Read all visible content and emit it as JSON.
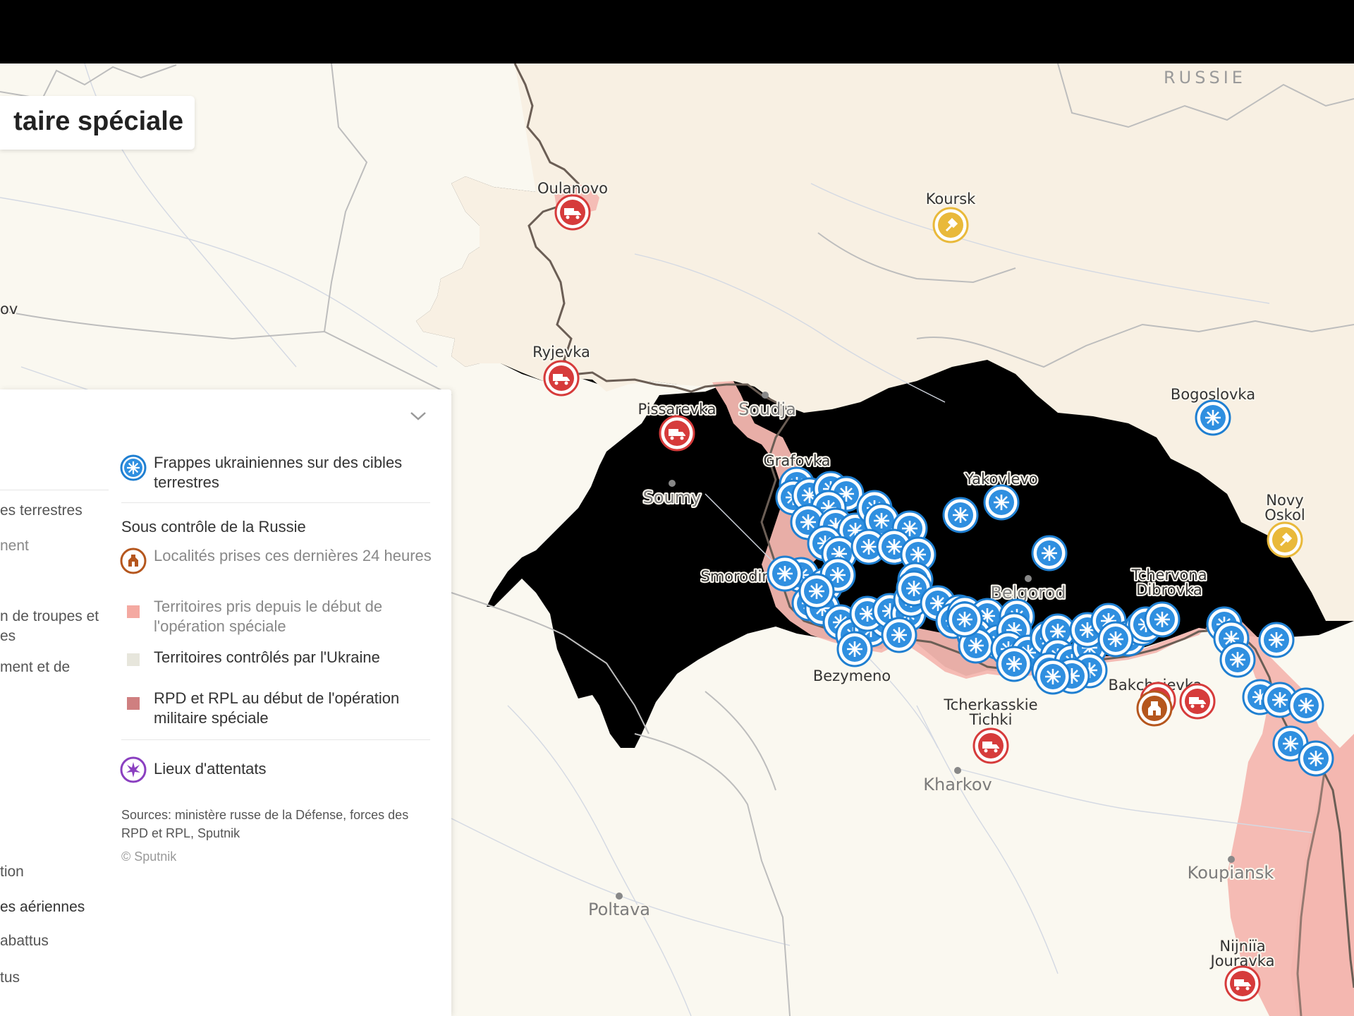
{
  "map": {
    "title": "taire spéciale",
    "country_label": "RUSSIE",
    "cities": [
      {
        "name": "Koursk",
        "style": "lbl"
      },
      {
        "name": "Soudja",
        "style": "lbl-big"
      },
      {
        "name": "Soumy",
        "style": "lbl-big"
      },
      {
        "name": "Belgorod",
        "style": "lbl-big"
      },
      {
        "name": "Kharkov",
        "style": "lbl-big"
      },
      {
        "name": "Poltava",
        "style": "lbl-big"
      },
      {
        "name": "Koupiansk",
        "style": "lbl-big"
      }
    ],
    "places": [
      "Oulanovo",
      "Ryjevka",
      "Pissarevka",
      "Grafovka",
      "Smorodino",
      "Bezymeno",
      "Yakovlevo",
      "Bogoslovka",
      "Novy Oskol",
      "Tchervona Dibrovka",
      "Bakcheievka",
      "Tcherkasskie Tichki",
      "Nijniïa Jouravka"
    ],
    "edge_label": "ov",
    "colors": {
      "russia_base": "#f8f0e3",
      "ukraine_base": "#faf8f0",
      "captured_area": "#f4b7b0",
      "strike_blue": "#1f7fd1",
      "vehicle_red": "#d63b3b",
      "settlement_brown": "#b5561d",
      "attack_yellow": "#e9b93a"
    }
  },
  "legend": {
    "cut_labels": [
      "es terrestres",
      "nent",
      "n de troupes et",
      "es",
      "ment et de",
      "tion",
      "es aériennes",
      "abattus",
      "tus"
    ],
    "items_top": [
      {
        "icon": "strike-icon",
        "label": "Frappes ukrainiennes sur des cibles terrestres"
      }
    ],
    "section_header": "Sous contrôle de la Russie",
    "items": [
      {
        "icon": "captured-settlement-icon",
        "label": "Localités prises ces dernières 24 heures",
        "muted": true
      },
      {
        "icon": "captured-territory-swatch",
        "label": "Territoires pris depuis le début de l'opération spéciale",
        "muted": true
      },
      {
        "icon": "ukraine-territory-swatch",
        "label": "Territoires contrôlés par l'Ukraine",
        "muted": false
      },
      {
        "icon": "dpr-lpr-swatch",
        "label": "RPD et RPL au début de l'opération militaire spéciale",
        "muted": false
      }
    ],
    "items_bottom": [
      {
        "icon": "attack-sites-icon",
        "label": "Lieux d'attentats"
      }
    ],
    "sources": "Sources: ministère russe de la Défense, forces des RPD et RPL, Sputnik",
    "copyright": "© Sputnik"
  }
}
